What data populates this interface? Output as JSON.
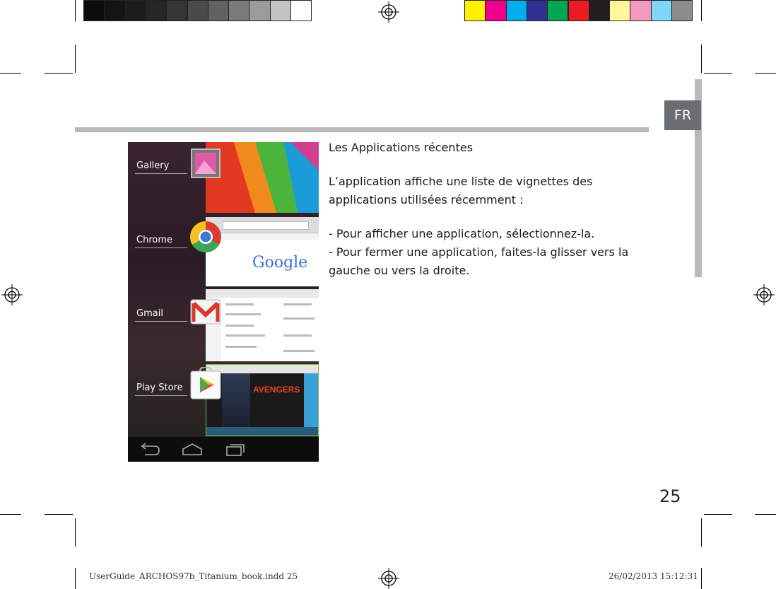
{
  "section_tab": "FR",
  "heading": "Les Applications récentes",
  "paragraphs": [
    "L’application affiche une liste de vignettes des",
    "applications utilisées récemment :",
    "- Pour afficher une application, sélectionnez-la.",
    "- Pour fermer une application, faites-la glisser vers la",
    "gauche ou vers la droite."
  ],
  "page_number": "25",
  "footer": {
    "file": "UserGuide_ARCHOS97b_Titanium_book.indd   25",
    "datetime": "26/02/2013   15:12:31"
  },
  "screenshot": {
    "apps": [
      {
        "label": "Gallery",
        "icon": "gallery-icon"
      },
      {
        "label": "Chrome",
        "icon": "chrome-icon"
      },
      {
        "label": "Gmail",
        "icon": "gmail-icon"
      },
      {
        "label": "Play Store",
        "icon": "play-store-icon"
      }
    ],
    "google_logo": "Google",
    "avengers_title": "AVENGERS",
    "nav_icons": [
      "back-icon",
      "home-icon",
      "recent-apps-icon"
    ]
  },
  "colors": {
    "grayscale_bar": [
      "#0d0d0d",
      "#141414",
      "#1c1c1c",
      "#262626",
      "#363636",
      "#4a4a4a",
      "#626262",
      "#7b7b7b",
      "#9b9b9b",
      "#c4c4c4",
      "#ffffff"
    ],
    "color_bar": [
      "#fff200",
      "#ec008c",
      "#00aeef",
      "#2e3192",
      "#00a651",
      "#ed1c24",
      "#231f20",
      "#fff799",
      "#f49ac1",
      "#7fd6f7",
      "#8c8c8c"
    ],
    "rule": "#b7b9bb",
    "tab": "#6b6e71"
  }
}
